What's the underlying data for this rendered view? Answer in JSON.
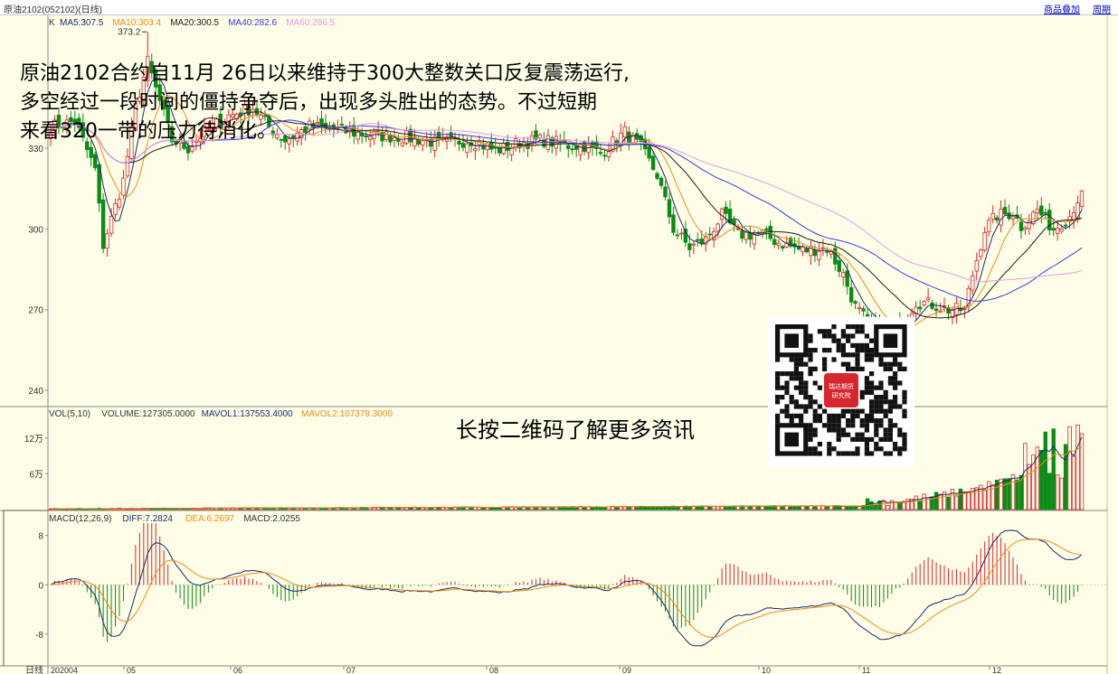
{
  "window": {
    "title": "原油2102(052102)(日线)",
    "links": [
      "商品叠加",
      "周期"
    ]
  },
  "colors": {
    "up": "#e0232b",
    "down": "#0a8c17",
    "background": "#fefee8",
    "ma5": "#1b2a6b",
    "ma10": "#f08a1a",
    "ma20": "#1a1a1a",
    "ma40": "#3a3adf",
    "ma60": "#e599e5"
  },
  "price_panel": {
    "indicator": "K",
    "legend": [
      {
        "label": "MA5:307.5",
        "color": "#1b2a6b"
      },
      {
        "label": "MA10:303.4",
        "color": "#f08a1a"
      },
      {
        "label": "MA20:300.5",
        "color": "#1a1a1a"
      },
      {
        "label": "MA40:282.6",
        "color": "#3a3adf"
      },
      {
        "label": "MA60:286.5",
        "color": "#e599e5"
      }
    ],
    "high_marker": "373.2",
    "y_ticks": [
      "330",
      "300",
      "270",
      "240"
    ]
  },
  "volume_panel": {
    "legend": [
      {
        "label": "VOL(5,10)",
        "color": "#333333"
      },
      {
        "label": "VOLUME:127305.0000",
        "color": "#333333"
      },
      {
        "label": "MAVOL1:137553.4000",
        "color": "#1b2a6b"
      },
      {
        "label": "MAVOL2:107379.3000",
        "color": "#f08a1a"
      }
    ],
    "y_ticks": [
      "12万",
      "6万"
    ]
  },
  "macd_panel": {
    "legend": [
      {
        "label": "MACD(12,26,9)",
        "color": "#333333"
      },
      {
        "label": "DIFF:7.2824",
        "color": "#1b2a6b"
      },
      {
        "label": "DEA:6.2697",
        "color": "#f08a1a"
      },
      {
        "label": "MACD:2.0255",
        "color": "#333333"
      }
    ],
    "y_ticks": [
      "8",
      "0",
      "-8"
    ]
  },
  "x_axis": {
    "period_label": "日线",
    "labels": [
      "202004",
      "05",
      "06",
      "07",
      "08",
      "09",
      "10",
      "11",
      "12"
    ]
  },
  "overlay": {
    "text_lines": [
      "原油2102合约自11月 26日以来维持于300大整数关口反复震荡运行,",
      "多空经过一段时间的僵持争夺后，出现多头胜出的态势。不过短期",
      "来看320一带的压力待消化。"
    ],
    "qr_logo_text": [
      "瑞达期货",
      "研究院"
    ],
    "qr_caption": "长按二维码了解更多资讯"
  },
  "chart_data": {
    "type": "candlestick",
    "title": "原油2102(052102)(日线)",
    "price_ylim": [
      235,
      378
    ],
    "high_label": 373.2,
    "month_labels": [
      "202004",
      "05",
      "06",
      "07",
      "08",
      "09",
      "10",
      "11",
      "12"
    ],
    "anchors": [
      {
        "i": 0,
        "c": 338
      },
      {
        "i": 6,
        "c": 340
      },
      {
        "i": 11,
        "c": 322
      },
      {
        "i": 13,
        "c": 294
      },
      {
        "i": 18,
        "c": 318
      },
      {
        "i": 21,
        "c": 345
      },
      {
        "i": 24,
        "c": 362
      },
      {
        "i": 26,
        "c": 352
      },
      {
        "i": 30,
        "c": 333
      },
      {
        "i": 34,
        "c": 330
      },
      {
        "i": 38,
        "c": 336
      },
      {
        "i": 44,
        "c": 342
      },
      {
        "i": 50,
        "c": 345
      },
      {
        "i": 54,
        "c": 338
      },
      {
        "i": 58,
        "c": 333
      },
      {
        "i": 64,
        "c": 338
      },
      {
        "i": 70,
        "c": 337
      },
      {
        "i": 78,
        "c": 335
      },
      {
        "i": 88,
        "c": 334
      },
      {
        "i": 96,
        "c": 332
      },
      {
        "i": 104,
        "c": 333
      },
      {
        "i": 110,
        "c": 329
      },
      {
        "i": 116,
        "c": 332
      },
      {
        "i": 122,
        "c": 333
      },
      {
        "i": 128,
        "c": 331
      },
      {
        "i": 132,
        "c": 331
      },
      {
        "i": 136,
        "c": 328
      },
      {
        "i": 142,
        "c": 336
      },
      {
        "i": 146,
        "c": 330
      },
      {
        "i": 150,
        "c": 320
      },
      {
        "i": 154,
        "c": 300
      },
      {
        "i": 158,
        "c": 293
      },
      {
        "i": 162,
        "c": 296
      },
      {
        "i": 166,
        "c": 305
      },
      {
        "i": 170,
        "c": 298
      },
      {
        "i": 176,
        "c": 298
      },
      {
        "i": 180,
        "c": 295
      },
      {
        "i": 186,
        "c": 292
      },
      {
        "i": 192,
        "c": 293
      },
      {
        "i": 196,
        "c": 283
      },
      {
        "i": 199,
        "c": 271
      },
      {
        "i": 204,
        "c": 262
      },
      {
        "i": 210,
        "c": 263
      },
      {
        "i": 214,
        "c": 273
      },
      {
        "i": 218,
        "c": 272
      },
      {
        "i": 222,
        "c": 270
      },
      {
        "i": 226,
        "c": 270
      },
      {
        "i": 228,
        "c": 283
      },
      {
        "i": 231,
        "c": 300
      },
      {
        "i": 234,
        "c": 305
      },
      {
        "i": 238,
        "c": 306
      },
      {
        "i": 240,
        "c": 301
      },
      {
        "i": 244,
        "c": 307
      },
      {
        "i": 248,
        "c": 300
      },
      {
        "i": 252,
        "c": 305
      },
      {
        "i": 255,
        "c": 314
      }
    ],
    "volume_ylim": [
      0,
      150000
    ],
    "volume_last": 127305,
    "macd_ylim": [
      -13,
      10
    ],
    "macd_last": {
      "diff": 7.2824,
      "dea": 6.2697,
      "macd": 2.0255
    }
  }
}
